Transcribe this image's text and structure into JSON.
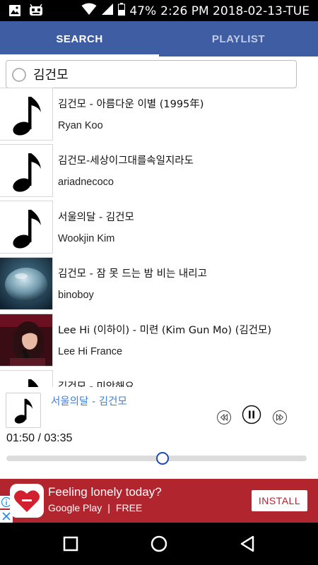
{
  "status_bar": {
    "battery": "47%",
    "time": "2:26 PM 2018-02-13-TUE",
    "left_icons": [
      "image-icon",
      "android-debug-icon"
    ],
    "right_icons": [
      "wifi-icon",
      "signal-icon",
      "battery-icon"
    ]
  },
  "tabs": [
    {
      "label": "SEARCH",
      "active": true
    },
    {
      "label": "PLAYLIST",
      "active": false
    }
  ],
  "search": {
    "value": "김건모",
    "icon": "search-icon"
  },
  "results": [
    {
      "title": "김건모 - 아름다운 이별 (1995年)",
      "artist": "Ryan Koo",
      "thumb": "music-note"
    },
    {
      "title": "김건모-세상이그대를속일지라도",
      "artist": "ariadnecoco",
      "thumb": "music-note"
    },
    {
      "title": "서울의달 - 김건모",
      "artist": "Wookjin Kim",
      "thumb": "music-note"
    },
    {
      "title": "김건모 - 잠 못 드는 밤 비는 내리고",
      "artist": "binoboy",
      "thumb": "water-drop-photo"
    },
    {
      "title": "Lee Hi (이하이) - 미련 (Kim Gun Mo) (김건모)",
      "artist": "Lee Hi France",
      "thumb": "singer-photo"
    },
    {
      "title": "김건모 - 미안해요",
      "artist": "",
      "thumb": "music-note"
    }
  ],
  "player": {
    "now_playing": "서울의달 - 김건모",
    "time": "01:50 / 03:35",
    "progress": 0.52,
    "controls": [
      "rewind-icon",
      "pause-icon",
      "fast-forward-icon"
    ]
  },
  "ad": {
    "title": "Feeling lonely today?",
    "store": "Google Play",
    "price": "FREE",
    "install_label": "INSTALL",
    "colors": {
      "background": "#b0252e",
      "button_text": "#b0252e"
    }
  },
  "nav": [
    "recents-icon",
    "home-icon",
    "back-icon"
  ],
  "colors": {
    "tab_bar": "#3f5da3",
    "now_playing_text": "#3f7fd9",
    "seek_thumb": "#1a49b8"
  }
}
